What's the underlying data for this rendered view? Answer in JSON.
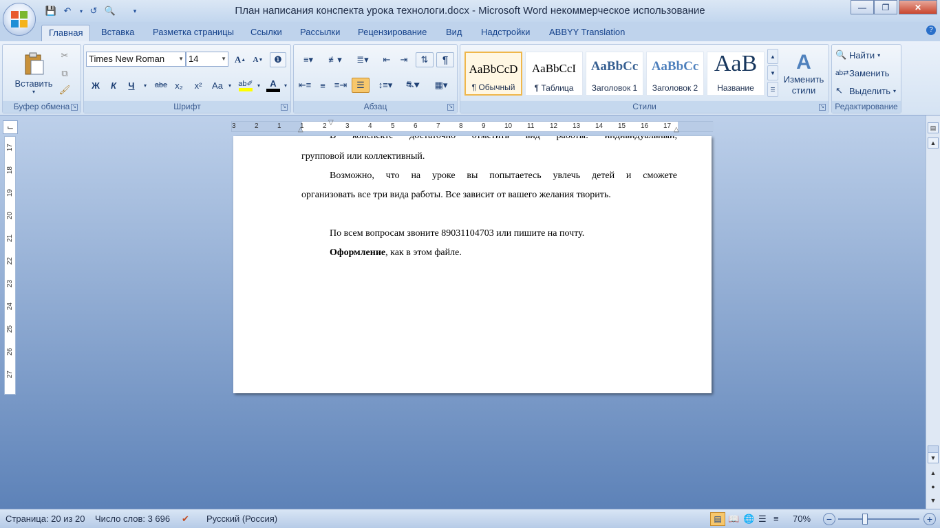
{
  "title": "План написания конспекта урока технологи.docx - Microsoft Word некоммерческое использование",
  "tabs": [
    "Главная",
    "Вставка",
    "Разметка страницы",
    "Ссылки",
    "Рассылки",
    "Рецензирование",
    "Вид",
    "Надстройки",
    "ABBYY Translation"
  ],
  "ribbon": {
    "clipboard": {
      "paste": "Вставить",
      "label": "Буфер обмена"
    },
    "font": {
      "name": "Times New Roman",
      "size": "14",
      "label": "Шрифт",
      "bold": "Ж",
      "italic": "К",
      "underline": "Ч",
      "strike": "abe",
      "sub": "x₂",
      "sup": "x²",
      "case": "Aa",
      "grow": "A",
      "shrink": "A"
    },
    "paragraph": {
      "label": "Абзац",
      "pilcrow": "¶"
    },
    "styles": {
      "label": "Стили",
      "items": [
        {
          "sample": "AaBbCcD",
          "name": "¶ Обычный"
        },
        {
          "sample": "AaBbCcI",
          "name": "¶ Таблица"
        },
        {
          "sample": "AaBbCc",
          "name": "Заголовок 1"
        },
        {
          "sample": "AaBbCc",
          "name": "Заголовок 2"
        },
        {
          "sample": "AaB",
          "name": "Название"
        }
      ],
      "change": "Изменить стили"
    },
    "editing": {
      "label": "Редактирование",
      "find": "Найти",
      "replace": "Заменить",
      "select": "Выделить"
    }
  },
  "ruler": {
    "h": [
      "3",
      "2",
      "1",
      "1",
      "2",
      "3",
      "4",
      "5",
      "6",
      "7",
      "8",
      "9",
      "10",
      "11",
      "12",
      "13",
      "14",
      "15",
      "16",
      "17"
    ],
    "v": [
      "17",
      "18",
      "19",
      "20",
      "21",
      "22",
      "23",
      "24",
      "25",
      "26",
      "27"
    ]
  },
  "doc": {
    "p0": "В конспекте достаточно отметить вид работы: индивидуальный,",
    "p1": "групповой или коллективный.",
    "p2a": "Возможно, что на уроке вы попытаетесь увлечь детей и сможете",
    "p2b": "организовать все три вида работы. Все зависит от вашего желания творить.",
    "p3": "По всем вопросам звоните 89031104703 или пишите на почту.",
    "p4bold": "Оформление",
    "p4rest": ", как в этом файле."
  },
  "status": {
    "page": "Страница: 20 из 20",
    "words": "Число слов: 3 696",
    "lang": "Русский (Россия)",
    "zoom": "70%"
  }
}
